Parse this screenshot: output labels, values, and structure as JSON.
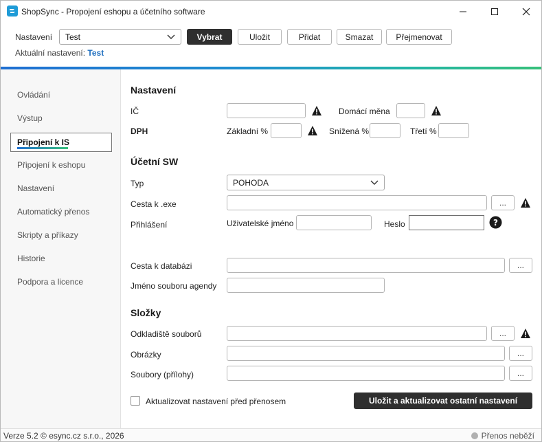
{
  "window": {
    "title": "ShopSync - Propojení eshopu a účetního software",
    "icon": "app-logo-icon"
  },
  "toolbar": {
    "settings_label": "Nastavení",
    "settings_value": "Test",
    "buttons": {
      "select": "Vybrat",
      "save": "Uložit",
      "add": "Přidat",
      "delete": "Smazat",
      "rename": "Přejmenovat"
    },
    "current_label": "Aktuální nastavení:",
    "current_value": "Test"
  },
  "sidebar": {
    "items": [
      {
        "label": "Ovládání"
      },
      {
        "label": "Výstup"
      },
      {
        "label": "Připojení k IS",
        "active": true
      },
      {
        "label": "Připojení k eshopu"
      },
      {
        "label": "Nastavení"
      },
      {
        "label": "Automatický přenos"
      },
      {
        "label": "Skripty a příkazy"
      },
      {
        "label": "Historie"
      },
      {
        "label": "Podpora a licence"
      }
    ]
  },
  "main": {
    "settings_section": {
      "title": "Nastavení",
      "ic_label": "IČ",
      "ic_value": "",
      "currency_label": "Domácí měna",
      "currency_value": "",
      "vat_label": "DPH",
      "vat_basic_label": "Základní %",
      "vat_reduced_label": "Snížená %",
      "vat_third_label": "Třetí %"
    },
    "accounting_section": {
      "title": "Účetní SW",
      "type_label": "Typ",
      "type_value": "POHODA",
      "exe_path_label": "Cesta k .exe",
      "browse_label": "...",
      "login_label": "Přihlášení",
      "username_label": "Uživatelské jméno",
      "password_label": "Heslo",
      "db_path_label": "Cesta k databázi",
      "agenda_file_label": "Jméno souboru agendy"
    },
    "folders_section": {
      "title": "Složky",
      "storage_label": "Odkladiště souborů",
      "images_label": "Obrázky",
      "attachments_label": "Soubory (přílohy)"
    },
    "update_checkbox_label": "Aktualizovat nastavení před přenosem",
    "update_checked": false,
    "save_update_button": "Uložit a aktualizovat ostatní nastavení"
  },
  "statusbar": {
    "version": "Verze 5.2  © esync.cz s.r.o., 2026",
    "transfer_status": "Přenos neběží"
  },
  "colors": {
    "accent_blue": "#1f6fbf",
    "gradient_start": "#1f6fd1",
    "gradient_end": "#37c07a",
    "dark_button": "#2f2f2f"
  }
}
